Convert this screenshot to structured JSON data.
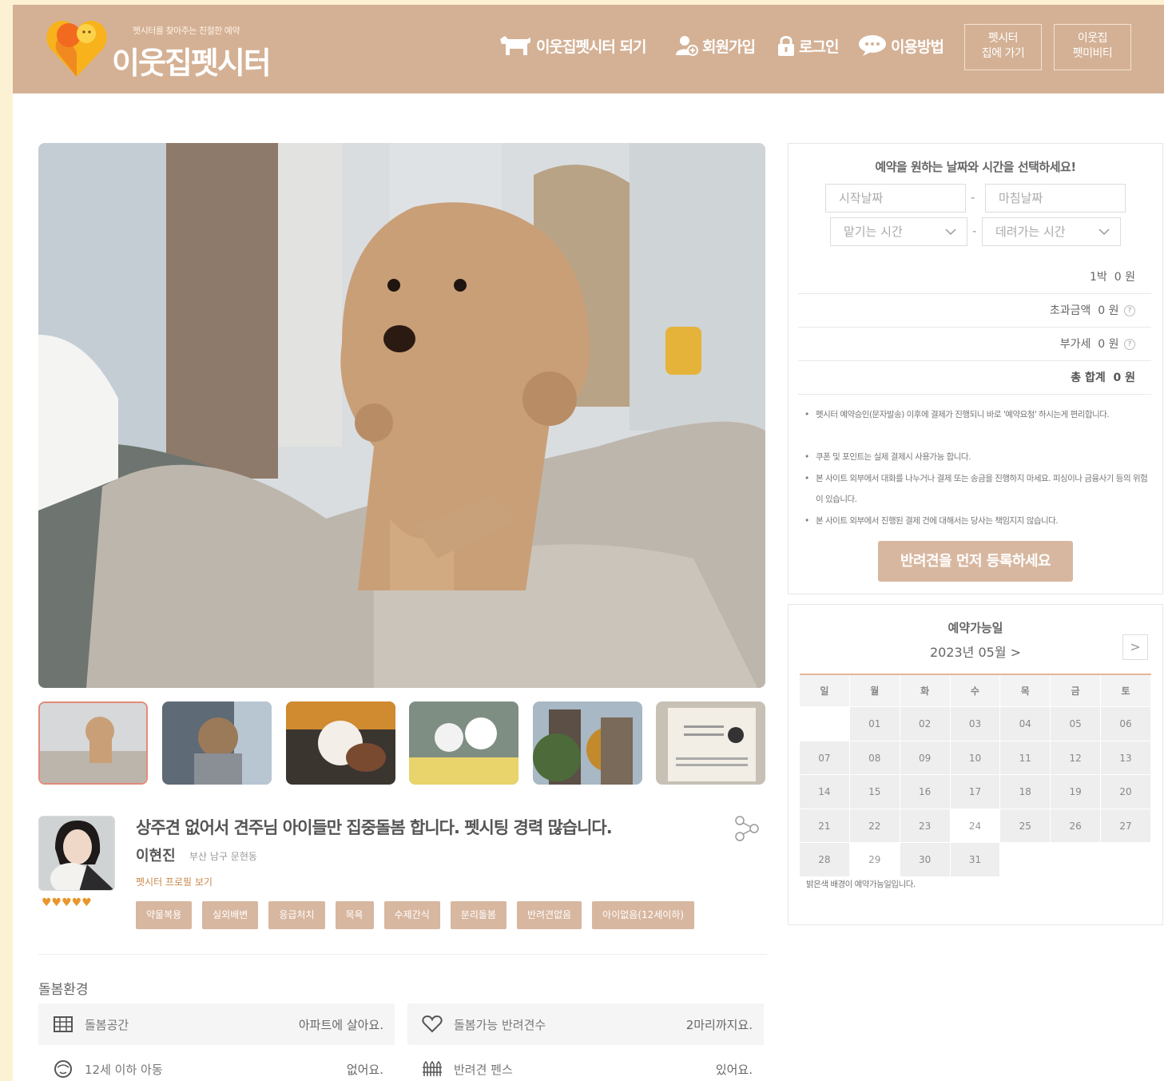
{
  "header": {
    "logo_tagline": "펫시터를 찾아주는 친절한 예약",
    "logo_name": "이웃집펫시터",
    "nav": {
      "become_sitter": "이웃집펫시터 되기",
      "signup": "회원가입",
      "login": "로그인",
      "how_to": "이용방법"
    },
    "btn_home_sitter": [
      "펫시터",
      "집에 가기"
    ],
    "btn_pet_beauty": [
      "이웃집",
      "펫미비티"
    ]
  },
  "colors": {
    "brand": "#d4b195",
    "tag": "#d8b7a0",
    "accent_star": "#e8962c",
    "page_bg": "#fdf1d4"
  },
  "gallery": {
    "thumb_count": 6,
    "selected_index": 0
  },
  "profile": {
    "title": "상주견 없어서 견주님 아이들만 집중돌봄 합니다. 펫시팅 경력 많습니다.",
    "name": "이현진",
    "location": "부산 남구 문현동",
    "profile_link": "펫시터 프로필 보기",
    "rating": 5,
    "stars": "♥♥♥♥♥",
    "tags": [
      "약물복용",
      "실외배변",
      "응급처치",
      "목욕",
      "수제간식",
      "분리돌봄",
      "반려견없음",
      "아이없음(12세이하)"
    ]
  },
  "environment": {
    "title": "돌봄환경",
    "items": [
      {
        "label": "돌봄공간",
        "value": "아파트에 살아요.",
        "icon": "building-icon"
      },
      {
        "label": "돌봄가능 반려견수",
        "value": "2마리까지요.",
        "icon": "heart-icon"
      },
      {
        "label": "12세 이하 아동",
        "value": "없어요.",
        "icon": "child-face-icon"
      },
      {
        "label": "반려견 펜스",
        "value": "있어요.",
        "icon": "fence-icon"
      }
    ]
  },
  "booking": {
    "title": "예약을 원하는 날짜와 시간을 선택하세요!",
    "start_date_placeholder": "시작날짜",
    "end_date_placeholder": "마침날짜",
    "dropoff_placeholder": "맡기는 시간",
    "pickup_placeholder": "데려가는 시간",
    "separator": "-",
    "rows": [
      {
        "label": "1박",
        "value": "0 원",
        "help": false,
        "bold": false
      },
      {
        "label": "초과금액",
        "value": "0 원",
        "help": true,
        "bold": false
      },
      {
        "label": "부가세",
        "value": "0 원",
        "help": true,
        "bold": false
      },
      {
        "label": "총 합계",
        "value": "0 원",
        "help": false,
        "bold": true
      }
    ],
    "help_glyph": "?",
    "notices": [
      "펫시터 예약승인(문자발송) 이후에 결제가 진행되니 바로 '예약요청' 하시는게 편리합니다.",
      "쿠폰 및 포인트는 실제 결제시 사용가능 합니다.",
      "본 사이트 외부에서 대화를 나누거나 결제 또는 송금을 진행하지 마세요. 피싱이나 금융사기 등의 위험이 있습니다.",
      "본 사이트 외부에서 진행된 결제 건에 대해서는 당사는 책임지지 않습니다."
    ],
    "register_button": "반려견을 먼저 등록하세요"
  },
  "calendar": {
    "title": "예약가능일",
    "month_label": "2023년 05월 >",
    "next_glyph": ">",
    "weekdays": [
      "일",
      "월",
      "화",
      "수",
      "목",
      "금",
      "토"
    ],
    "weeks": [
      [
        "",
        "01",
        "02",
        "03",
        "04",
        "05",
        "06"
      ],
      [
        "07",
        "08",
        "09",
        "10",
        "11",
        "12",
        "13"
      ],
      [
        "14",
        "15",
        "16",
        "17",
        "18",
        "19",
        "20"
      ],
      [
        "21",
        "22",
        "23",
        "24",
        "25",
        "26",
        "27"
      ],
      [
        "28",
        "29",
        "30",
        "31",
        "",
        "",
        ""
      ]
    ],
    "unavailable": [
      "24",
      "29"
    ],
    "note": "밝은색 배경이 예약가능일입니다."
  }
}
